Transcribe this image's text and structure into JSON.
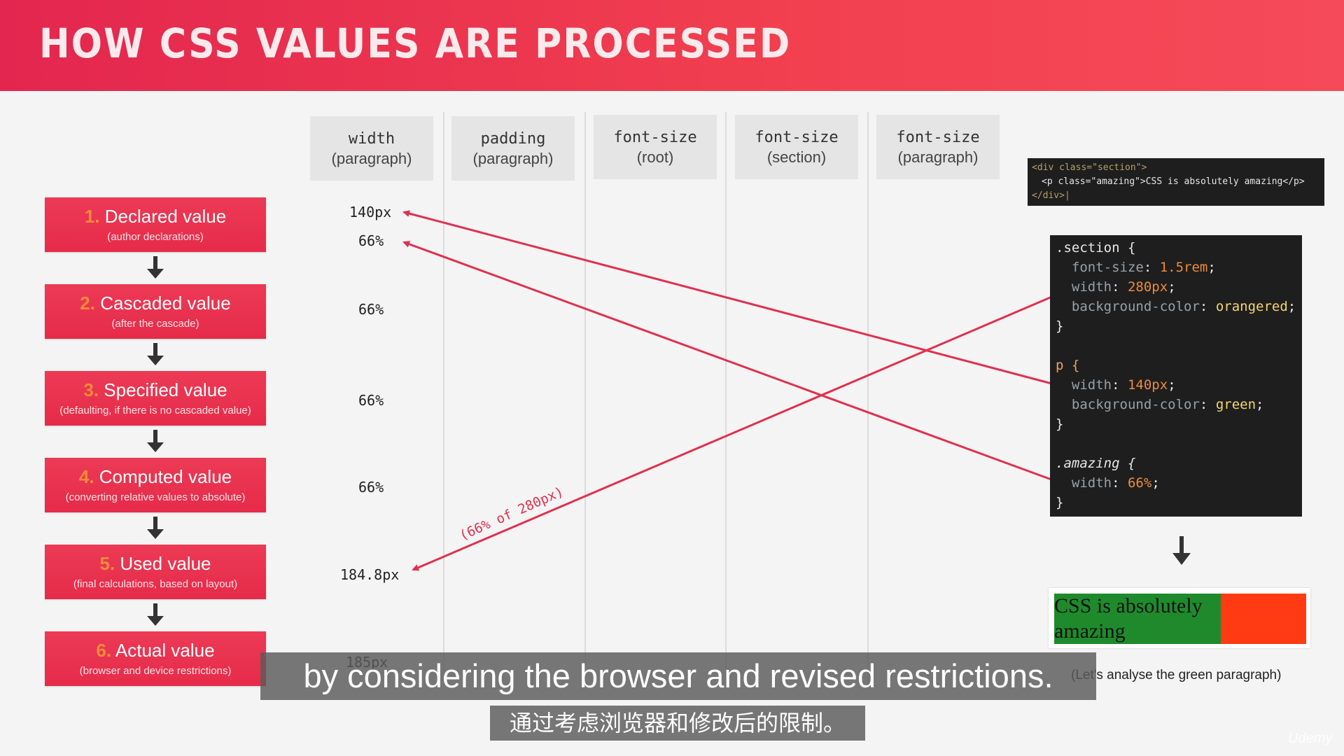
{
  "header": {
    "title": "HOW CSS VALUES ARE PROCESSED"
  },
  "steps": [
    {
      "num": "1.",
      "label": "Declared value",
      "sub": "(author declarations)"
    },
    {
      "num": "2.",
      "label": "Cascaded value",
      "sub": "(after the cascade)"
    },
    {
      "num": "3.",
      "label": "Specified value",
      "sub": "(defaulting, if there is no cascaded value)"
    },
    {
      "num": "4.",
      "label": "Computed value",
      "sub": "(converting relative values to absolute)"
    },
    {
      "num": "5.",
      "label": "Used value",
      "sub": "(final calculations, based on layout)"
    },
    {
      "num": "6.",
      "label": "Actual value",
      "sub": "(browser and device restrictions)"
    }
  ],
  "columns": [
    {
      "prop": "width",
      "target": "(paragraph)"
    },
    {
      "prop": "padding",
      "target": "(paragraph)"
    },
    {
      "prop": "font-size",
      "target": "(root)"
    },
    {
      "prop": "font-size",
      "target": "(section)"
    },
    {
      "prop": "font-size",
      "target": "(paragraph)"
    }
  ],
  "width_values": {
    "declared_1": "140px",
    "declared_2": "66%",
    "cascaded": "66%",
    "specified": "66%",
    "computed": "66%",
    "used": "184.8px",
    "actual": "185px"
  },
  "annotation": "(66% of 280px)",
  "html_code": {
    "line1": "<div class=\"section\">",
    "line2": "<p class=\"amazing\">CSS is absolutely amazing</p>",
    "line3": "</div>|"
  },
  "css_code": {
    "section_sel": ".section {",
    "section_fs_prop": "font-size",
    "section_fs_val": "1.5rem",
    "section_w_prop": "width",
    "section_w_val": "280px",
    "section_bg_prop": "background-color",
    "section_bg_val": "orangered",
    "close": "}",
    "p_sel": "p {",
    "p_w_prop": "width",
    "p_w_val": "140px",
    "p_bg_prop": "background-color",
    "p_bg_val": "green",
    "amazing_sel": ".amazing {",
    "amazing_w_prop": "width",
    "amazing_w_val": "66%"
  },
  "result": {
    "text": "CSS is absolutely amazing",
    "caption": "(Let's analyse the green paragraph)"
  },
  "subtitles": {
    "en": "by considering the browser and revised restrictions.",
    "zh": "通过考虑浏览器和修改后的限制。"
  },
  "brand": "Udemy",
  "colors": {
    "accent": "#e62b49",
    "arrow": "#e0304f",
    "green": "#1f8a2c",
    "orangered": "#ff3b14"
  }
}
